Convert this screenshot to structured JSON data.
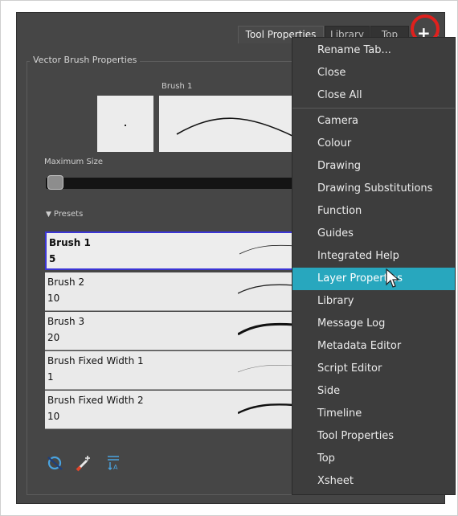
{
  "tabs": [
    {
      "label": "Tool Properties",
      "active": true
    },
    {
      "label": "Library",
      "active": false
    },
    {
      "label": "Top",
      "active": false
    }
  ],
  "add_tab_icon": "plus-icon",
  "vector_brush": {
    "group_title": "Vector Brush Properties",
    "preview_label": "Brush 1",
    "max_size_label": "Maximum Size",
    "max_size_fraction": 0.02
  },
  "presets": {
    "header": "Presets",
    "items": [
      {
        "name": "Brush 1",
        "size": "5",
        "selected": true
      },
      {
        "name": "Brush 2",
        "size": "10",
        "selected": false
      },
      {
        "name": "Brush 3",
        "size": "20",
        "selected": false
      },
      {
        "name": "Brush Fixed Width 1",
        "size": "1",
        "selected": false
      },
      {
        "name": "Brush Fixed Width 2",
        "size": "10",
        "selected": false
      }
    ]
  },
  "bottom_icons": [
    "stroke-icon",
    "brush-plus-icon",
    "sort-icon"
  ],
  "context_menu": {
    "group1": [
      "Rename Tab...",
      "Close",
      "Close All"
    ],
    "group2": [
      "Camera",
      "Colour",
      "Drawing",
      "Drawing Substitutions",
      "Function",
      "Guides",
      "Integrated Help",
      "Layer Properties",
      "Library",
      "Message Log",
      "Metadata Editor",
      "Script Editor",
      "Side",
      "Timeline",
      "Tool Properties",
      "Top",
      "Xsheet"
    ],
    "hovered": "Layer Properties"
  },
  "colors": {
    "panel_bg": "#464646",
    "menu_bg": "#3d3d3d",
    "menu_hover": "#28a7be",
    "selection_border": "#3b35d6",
    "highlight_circle": "#e0201d"
  }
}
